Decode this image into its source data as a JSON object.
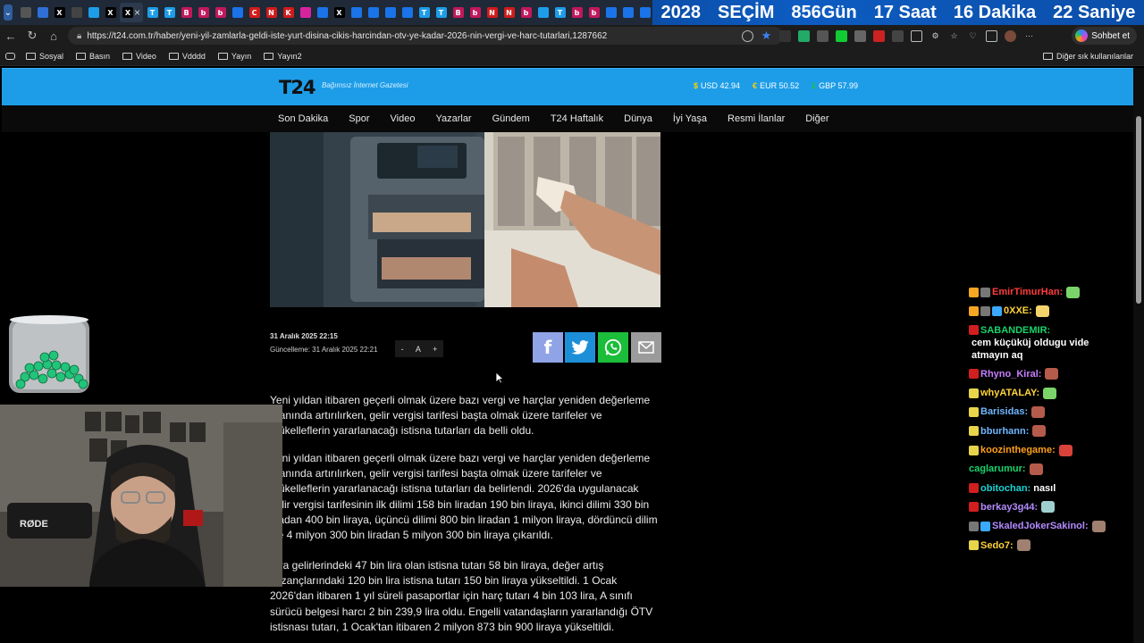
{
  "browser": {
    "tabs": [
      {
        "icon": "tab-list-icon"
      },
      {
        "icon": "copilot-icon"
      },
      {
        "icon": "x-icon",
        "label": "X"
      },
      {
        "icon": "github-icon"
      },
      {
        "icon": "t24-icon"
      },
      {
        "icon": "x-icon",
        "label": "X"
      },
      {
        "icon": "x-icon",
        "label": "X",
        "active": true
      },
      {
        "icon": "t24-icon",
        "label": "T24"
      },
      {
        "icon": "t24-icon",
        "label": "T24"
      },
      {
        "icon": "b-icon",
        "label": "B"
      },
      {
        "icon": "b-icon",
        "label": "b"
      },
      {
        "icon": "b-icon",
        "label": "b"
      },
      {
        "icon": "news-icon"
      },
      {
        "icon": "c-icon",
        "label": "C"
      },
      {
        "icon": "n-icon",
        "label": "N"
      },
      {
        "icon": "k-icon",
        "label": "K"
      },
      {
        "icon": "instagram-icon"
      },
      {
        "icon": "news-icon"
      },
      {
        "icon": "x-icon",
        "label": "X"
      },
      {
        "icon": "news-icon"
      },
      {
        "icon": "news-icon"
      },
      {
        "icon": "news-icon"
      },
      {
        "icon": "news-icon"
      },
      {
        "icon": "t24-icon",
        "label": "T24"
      },
      {
        "icon": "t24-icon",
        "label": "T24"
      },
      {
        "icon": "b-icon",
        "label": "B"
      },
      {
        "icon": "b-icon",
        "label": "b"
      },
      {
        "icon": "n-icon",
        "label": "N"
      },
      {
        "icon": "n-icon",
        "label": "N"
      },
      {
        "icon": "b-icon",
        "label": "b"
      },
      {
        "icon": "circle-icon"
      },
      {
        "icon": "t24-icon",
        "label": "T24"
      },
      {
        "icon": "b-icon",
        "label": "b"
      },
      {
        "icon": "b-icon",
        "label": "b"
      },
      {
        "icon": "news-icon"
      },
      {
        "icon": "news-icon"
      },
      {
        "icon": "news-icon"
      }
    ],
    "url": "https://t24.com.tr/haber/yeni-yil-zamlarla-geldi-iste-yurt-disina-cikis-harcindan-otv-ye-kadar-2026-nin-vergi-ve-harc-tutarlari,1287662",
    "chat_button_label": "Sohbet et",
    "bookmarks": [
      "Sosyal",
      "Basın",
      "Video",
      "Vdddd",
      "Yayın",
      "Yayın2"
    ],
    "other_bookmarks_label": "Diğer sık kullanılanlar"
  },
  "countdown": {
    "year": "2028",
    "label": "SEÇİM",
    "days": "856Gün",
    "hours": "17 Saat",
    "minutes": "16 Dakika",
    "seconds": "22 Saniye"
  },
  "site": {
    "logo": "T24",
    "tagline": "Bağımsız İnternet Gazetesi",
    "rates": [
      {
        "symbol": "$",
        "label": "USD 42.94"
      },
      {
        "symbol": "€",
        "label": "EUR 50.52"
      },
      {
        "symbol": "£",
        "label": "GBP 57.99"
      }
    ],
    "nav": [
      "Son Dakika",
      "Spor",
      "Video",
      "Yazarlar",
      "Gündem",
      "T24 Haftalık",
      "Dünya",
      "İyi Yaşa",
      "Resmi İlanlar",
      "Diğer"
    ]
  },
  "article": {
    "published": "31 Aralık 2025 22:15",
    "updated": "Güncelleme: 31 Aralık 2025 22:21",
    "font_controls": [
      "-",
      "A",
      "+"
    ],
    "paragraphs": [
      "Yeni yıldan itibaren geçerli olmak üzere bazı vergi ve harçlar yeniden değerleme\noranında artırılırken, gelir vergisi tarifesi başta olmak üzere tarifeler ve\nmükelleflerin yararlanacağı istisna tutarları da belli oldu.",
      "Yeni yıldan itibaren geçerli olmak üzere bazı vergi ve harçlar yeniden değerleme\noranında artırılırken, gelir vergisi tarifesi başta olmak üzere tarifeler ve\nmükelleflerin yararlanacağı istisna tutarları da belirlendi. 2026'da uygulanacak\ngelir vergisi tarifesinin ilk dilimi 158 bin liradan 190 bin liraya, ikinci dilimi 330 bin\nliradan 400 bin liraya, üçüncü dilimi 800 bin liradan 1 milyon liraya, dördüncü dilim\nise 4 milyon 300 bin liradan 5 milyon 300 bin liraya çıkarıldı.",
      "Kira gelirlerindeki 47 bin lira olan istisna tutarı 58 bin liraya, değer artış\nkazançlarındaki 120 bin lira istisna tutarı 150 bin liraya yükseltildi. 1 Ocak\n2026'dan itibaren 1 yıl süreli pasaportlar için harç tutarı 4 bin 103 lira, A sınıfı\nsürücü belgesi harcı 2 bin 239,9 lira oldu. Engelli vatandaşların yararlandığı ÖTV\nistisnası tutarı, 1 Ocak'tan itibaren 2 milyon 873 bin 900 liraya yükseltildi."
    ]
  },
  "chat": [
    {
      "user": "EmirTimurHan:",
      "color": "#ff3b3b",
      "message": "",
      "badges": [
        "#f5a623",
        "#777777"
      ],
      "emote": "#7bd46a"
    },
    {
      "user": "0XXE:",
      "color": "#ffd23a",
      "message": "",
      "badges": [
        "#f5a623",
        "#777777",
        "#3ba9ff"
      ],
      "emote": "#f2d46b"
    },
    {
      "user": "SABANDEMIR:",
      "color": "#19d36b",
      "message": "cem küçüküj oldugu vide atmayın aq",
      "badges": [
        "#d11f1f"
      ],
      "emote": ""
    },
    {
      "user": "Rhyno_Kiral:",
      "color": "#c77dff",
      "message": "",
      "badges": [
        "#d11f1f"
      ],
      "emote": "#b55b4b"
    },
    {
      "user": "whyATALAY:",
      "color": "#ffd23a",
      "message": "",
      "badges": [
        "#e8d44a"
      ],
      "emote": "#7bd46a"
    },
    {
      "user": "Barisidas:",
      "color": "#6fb6ff",
      "message": "",
      "badges": [
        "#e8d44a"
      ],
      "emote": "#b55b4b"
    },
    {
      "user": "bburhann:",
      "color": "#6fb6ff",
      "message": "",
      "badges": [
        "#e8d44a"
      ],
      "emote": "#b55b4b"
    },
    {
      "user": "koozinthegame:",
      "color": "#ff9f1a",
      "message": "",
      "badges": [
        "#e8d44a"
      ],
      "emote": "#d9423a"
    },
    {
      "user": "caglarumur:",
      "color": "#19d36b",
      "message": "",
      "badges": [],
      "emote": "#b55b4b"
    },
    {
      "user": "obitochan:",
      "color": "#19d3d3",
      "message": "nasıl",
      "badges": [
        "#d11f1f"
      ],
      "emote": ""
    },
    {
      "user": "berkay3g44:",
      "color": "#b38bff",
      "message": "",
      "badges": [
        "#d11f1f"
      ],
      "emote": "#9fd0d0"
    },
    {
      "user": "SkaledJokerSakinol:",
      "color": "#b38bff",
      "message": "",
      "badges": [
        "#777777",
        "#3ba9ff"
      ],
      "emote": "#a08070"
    },
    {
      "user": "Sedo7:",
      "color": "#ffd23a",
      "message": "",
      "badges": [
        "#e8d44a"
      ],
      "emote": "#a08070"
    }
  ]
}
